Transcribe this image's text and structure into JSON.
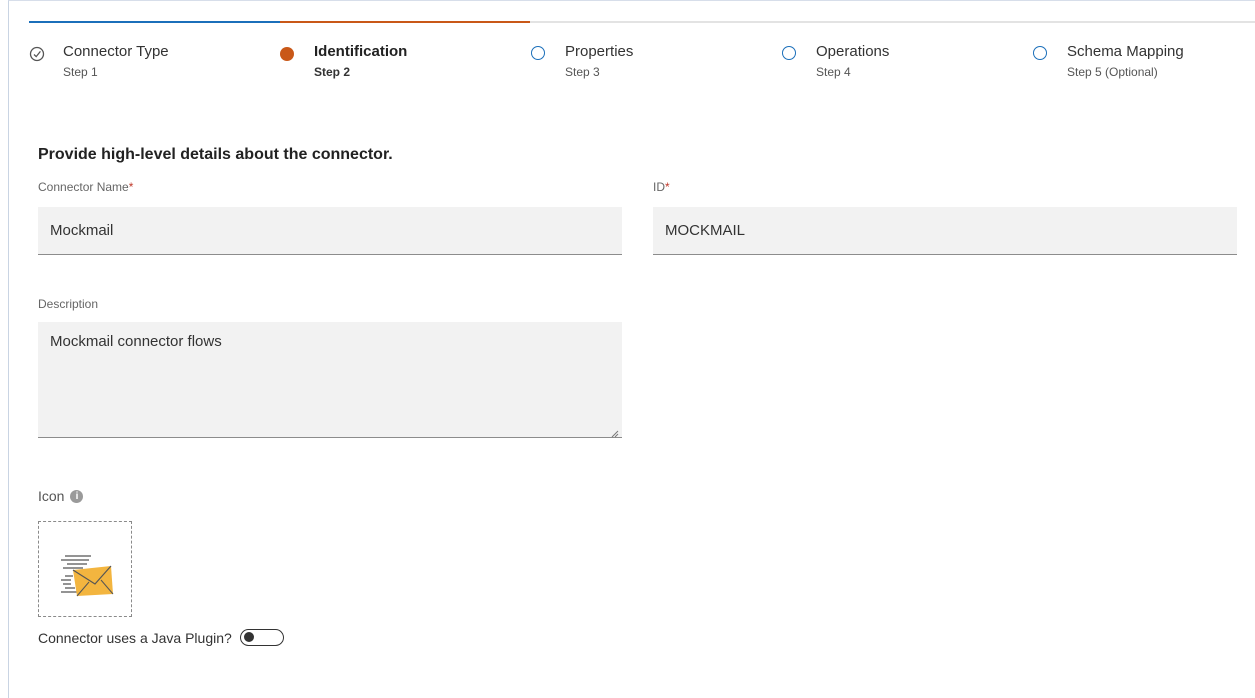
{
  "stepper": {
    "steps": [
      {
        "label": "Connector Type",
        "sub": "Step 1",
        "state": "done"
      },
      {
        "label": "Identification",
        "sub": "Step 2",
        "state": "active"
      },
      {
        "label": "Properties",
        "sub": "Step 3",
        "state": "pending"
      },
      {
        "label": "Operations",
        "sub": "Step 4",
        "state": "pending"
      },
      {
        "label": "Schema Mapping",
        "sub": "Step 5 (Optional)",
        "state": "pending"
      }
    ],
    "colors": {
      "done": "#1b6fba",
      "active": "#c95818",
      "track": "#e3e3e3"
    }
  },
  "form": {
    "heading": "Provide high-level details about the connector.",
    "name": {
      "label": "Connector Name",
      "required_mark": "*",
      "value": "Mockmail"
    },
    "id": {
      "label": "ID",
      "required_mark": "*",
      "value": "MOCKMAIL"
    },
    "description": {
      "label": "Description",
      "value": "Mockmail connector flows"
    },
    "icon": {
      "label": "Icon",
      "info_glyph": "i",
      "image": "envelope-icon"
    },
    "java_plugin": {
      "label": "Connector uses a Java Plugin?",
      "enabled": false
    }
  }
}
